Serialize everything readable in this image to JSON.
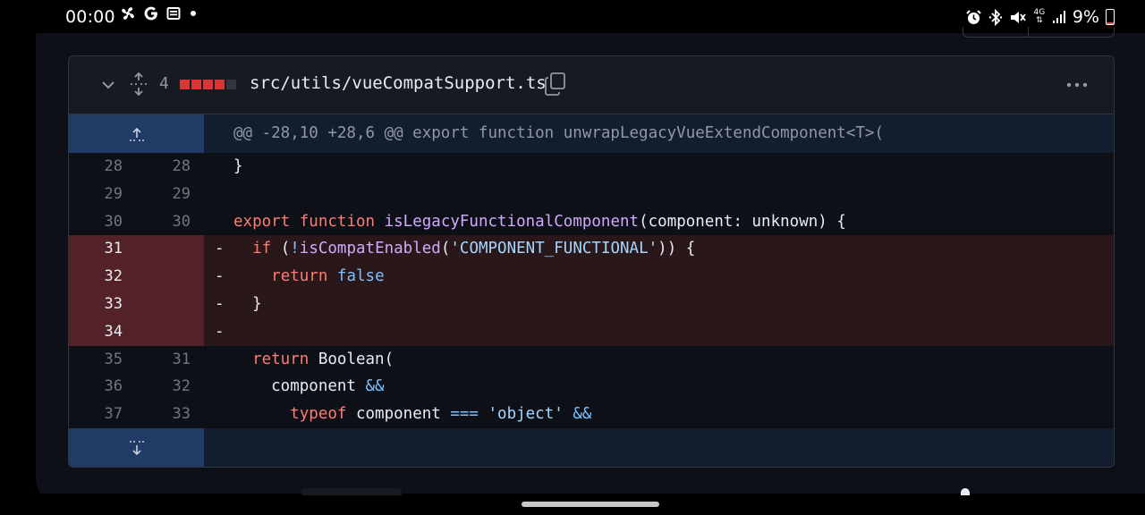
{
  "status_bar": {
    "time": "00:00",
    "left_icons": [
      "pinwheel-icon",
      "google-icon",
      "news-icon",
      "dot-icon"
    ],
    "right_icons": [
      "alarm-icon",
      "bluetooth-icon",
      "mute-icon",
      "4g-icon",
      "signal-icon"
    ],
    "network": "4G",
    "battery_percent": "9%"
  },
  "file": {
    "change_count": "4",
    "path": "src/utils/vueCompatSupport.ts",
    "diffstat": [
      "del",
      "del",
      "del",
      "del",
      "neutral"
    ],
    "colors": {
      "deletion": "#da3633",
      "neutral": "#30363d"
    }
  },
  "diff": {
    "hunk_header": "@@ -28,10 +28,6 @@ export function unwrapLegacyVueExtendComponent<T>(",
    "lines": [
      {
        "old": "28",
        "new": "28",
        "type": "context",
        "code": "}"
      },
      {
        "old": "29",
        "new": "29",
        "type": "context",
        "code": ""
      },
      {
        "old": "30",
        "new": "30",
        "type": "context",
        "code": "export function isLegacyFunctionalComponent(component: unknown) {"
      },
      {
        "old": "31",
        "new": "",
        "type": "del",
        "marker": "-",
        "code": "  if (!isCompatEnabled('COMPONENT_FUNCTIONAL')) {"
      },
      {
        "old": "32",
        "new": "",
        "type": "del",
        "marker": "-",
        "code": "    return false"
      },
      {
        "old": "33",
        "new": "",
        "type": "del",
        "marker": "-",
        "code": "  }"
      },
      {
        "old": "34",
        "new": "",
        "type": "del",
        "marker": "-",
        "code": ""
      },
      {
        "old": "35",
        "new": "31",
        "type": "context",
        "code": "  return Boolean("
      },
      {
        "old": "36",
        "new": "32",
        "type": "context",
        "code": "    component &&"
      },
      {
        "old": "37",
        "new": "33",
        "type": "context",
        "code": "      typeof component === 'object' &&"
      }
    ]
  }
}
